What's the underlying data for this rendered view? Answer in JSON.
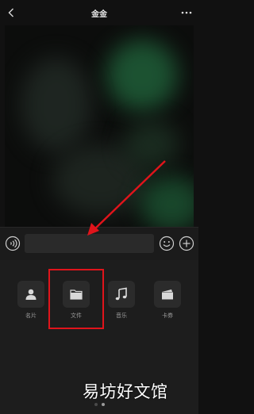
{
  "header": {
    "title": "金金",
    "back_icon": "chevron-left-icon",
    "more_icon": "ellipsis-icon"
  },
  "input_bar": {
    "voice_icon": "voice-icon",
    "emoji_icon": "emoji-icon",
    "add_icon": "plus-circle-icon",
    "text_value": ""
  },
  "tools": [
    {
      "label": "名片",
      "icon": "person-card-icon"
    },
    {
      "label": "文件",
      "icon": "folder-icon"
    },
    {
      "label": "音乐",
      "icon": "music-note-icon"
    },
    {
      "label": "卡券",
      "icon": "coupon-icon"
    }
  ],
  "pager": {
    "pages": 2,
    "current": 2
  },
  "annotation": {
    "color": "#e0141b"
  },
  "watermark": "易坊好文馆"
}
